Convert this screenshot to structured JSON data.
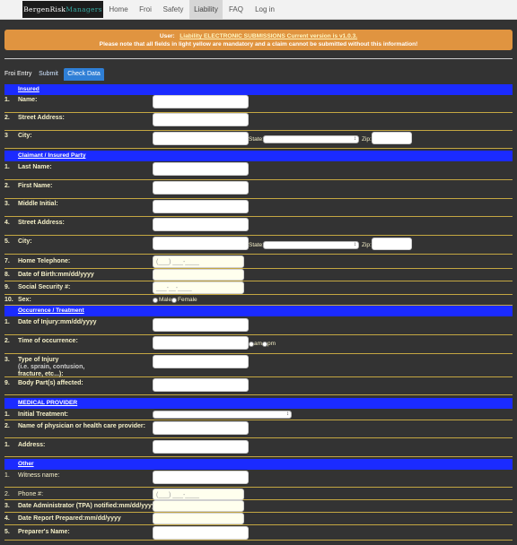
{
  "nav": {
    "brand_a": "BergenRisk",
    "brand_b": "Managers",
    "items": [
      "Home",
      "Froi",
      "Safety",
      "Liability",
      "FAQ",
      "Log in"
    ]
  },
  "banner": {
    "user_label": "User:",
    "notice": "Liability ELECTRONIC SUBMISSIONS Current version is v1.0.3.",
    "warning": "Please note that all fields in light yellow are mandatory and a claim cannot be submitted without this information!"
  },
  "tabs": {
    "label": "Froi Entry",
    "submit": "Submit",
    "check": "Check Data"
  },
  "labels": {
    "state": "State:",
    "zip": "Zip:",
    "male": "Male",
    "female": "Female",
    "am": "am",
    "pm": "pm",
    "phone_mask": "(___) ___-____",
    "ssn_mask": "___-__-____"
  },
  "sections": {
    "insured": "Insured",
    "claimant": "Claimant / Insured Party",
    "occurrence": "Occurrence / Treatment",
    "medical": "MEDICAL PROVIDER",
    "other": "Other"
  },
  "insured": [
    {
      "num": "1.",
      "label": "Name:"
    },
    {
      "num": "2.",
      "label": "Street Address:"
    },
    {
      "num": "3",
      "label": "City:"
    }
  ],
  "claimant": [
    {
      "num": "1.",
      "label": "Last Name:"
    },
    {
      "num": "2.",
      "label": "First Name:"
    },
    {
      "num": "3.",
      "label": "Middle Initial:"
    },
    {
      "num": "4.",
      "label": "Street Address:"
    },
    {
      "num": "5.",
      "label": "City:"
    },
    {
      "num": "7.",
      "label": "Home Telephone:"
    },
    {
      "num": "8.",
      "label": "Date of Birth:mm/dd/yyyy"
    },
    {
      "num": "9.",
      "label": "Social Security #:"
    },
    {
      "num": "10.",
      "label": "Sex:"
    }
  ],
  "occurrence": [
    {
      "num": "1.",
      "label": "Date of Injury:mm/dd/yyyy"
    },
    {
      "num": "2.",
      "label": "Time of occurrence:"
    },
    {
      "num": "3.",
      "label": "Type of Injury",
      "sub1": "(i.e. sprain, contusion,",
      "sub2": "fracture, etc...):"
    },
    {
      "num": "9.",
      "label": "Body Part(s) affected:"
    }
  ],
  "medical": [
    {
      "num": "1.",
      "label": "Initial Treatment:"
    },
    {
      "num": "2.",
      "label": "Name of physician or health care provider:"
    },
    {
      "num": "1.",
      "label": "Address:"
    }
  ],
  "other": [
    {
      "num": "1.",
      "label": "Witness name:"
    },
    {
      "num": "2.",
      "label": "Phone #:"
    },
    {
      "num": "3.",
      "label": "Date Administrator (TPA) notified:mm/dd/yyyy"
    },
    {
      "num": "4.",
      "label": "Date Report Prepared:mm/dd/yyyy"
    },
    {
      "num": "5.",
      "label": "Preparer's Name:"
    }
  ],
  "colors": {
    "section_bg": "#1b2bff",
    "banner_bg": "#e09440",
    "page_bg": "#333333",
    "row_rule": "#c4a742",
    "active_tab": "#2f7fd6"
  }
}
